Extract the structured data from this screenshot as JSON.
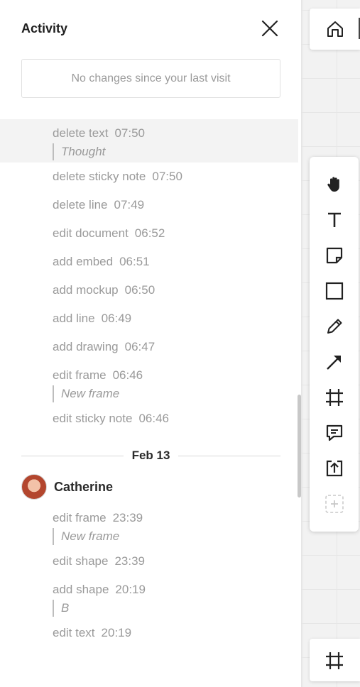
{
  "panel": {
    "title": "Activity",
    "notice": "No changes since your last visit"
  },
  "feed_top": [
    {
      "action": "delete text",
      "time": "07:50",
      "quote": "Thought",
      "highlight": true
    },
    {
      "action": "delete sticky note",
      "time": "07:50"
    },
    {
      "action": "delete line",
      "time": "07:49"
    },
    {
      "action": "edit document",
      "time": "06:52"
    },
    {
      "action": "add embed",
      "time": "06:51"
    },
    {
      "action": "add mockup",
      "time": "06:50"
    },
    {
      "action": "add line",
      "time": "06:49"
    },
    {
      "action": "add drawing",
      "time": "06:47"
    },
    {
      "action": "edit frame",
      "time": "06:46",
      "quote": "New frame"
    },
    {
      "action": "edit sticky note",
      "time": "06:46"
    }
  ],
  "date_group": {
    "date": "Feb 13",
    "user": "Catherine",
    "entries": [
      {
        "action": "edit frame",
        "time": "23:39",
        "quote": "New frame"
      },
      {
        "action": "edit shape",
        "time": "23:39"
      },
      {
        "action": "add shape",
        "time": "20:19",
        "quote": "B"
      },
      {
        "action": "edit text",
        "time": "20:19"
      }
    ]
  },
  "toolbar": {
    "tools": [
      "hand-icon",
      "text-icon",
      "sticky-note-icon",
      "rectangle-icon",
      "pen-icon",
      "arrow-icon",
      "frame-icon",
      "comment-icon",
      "upload-icon",
      "add-more-icon"
    ]
  }
}
